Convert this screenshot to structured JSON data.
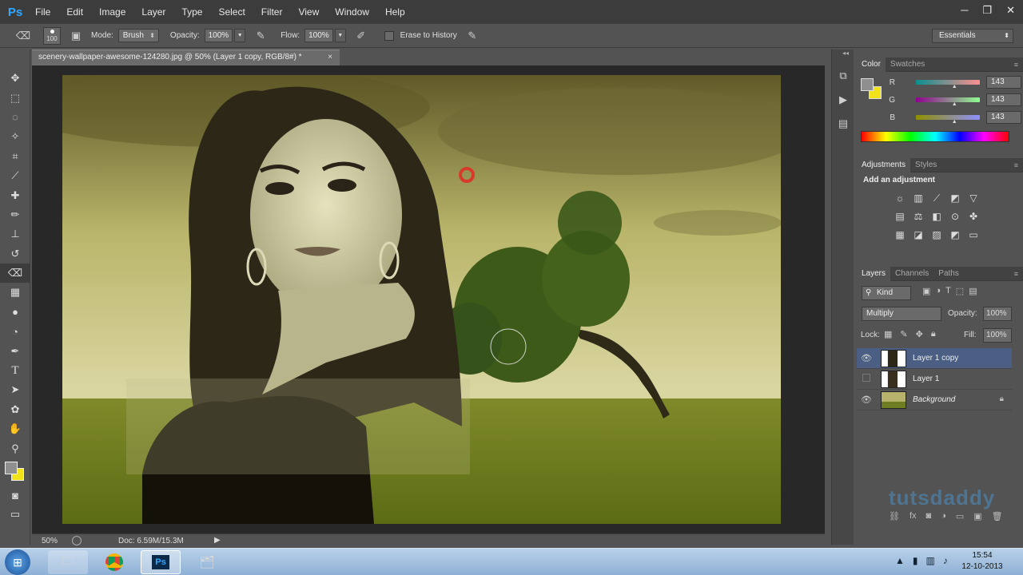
{
  "app": {
    "logo": "Ps"
  },
  "menu": [
    "File",
    "Edit",
    "Image",
    "Layer",
    "Type",
    "Select",
    "Filter",
    "View",
    "Window",
    "Help"
  ],
  "window_controls": {
    "minimize": "─",
    "restore": "❐",
    "close": "✕"
  },
  "options_bar": {
    "brush_size": "100",
    "mode_label": "Mode:",
    "mode_value": "Brush",
    "opacity_label": "Opacity:",
    "opacity_value": "100%",
    "flow_label": "Flow:",
    "flow_value": "100%",
    "erase_history_label": "Erase to History",
    "workspace": "Essentials"
  },
  "document": {
    "tab_title": "scenery-wallpaper-awesome-124280.jpg @ 50% (Layer 1 copy, RGB/8#) *",
    "close": "×"
  },
  "status_bar": {
    "zoom": "50%",
    "doc_info": "Doc: 6.59M/15.3M"
  },
  "color_panel": {
    "tabs": [
      "Color",
      "Swatches"
    ],
    "channels": [
      {
        "name": "R",
        "value": "143",
        "gradient": "linear-gradient(90deg,#0a8f8f,#ff8f8f)",
        "position": 0.56
      },
      {
        "name": "G",
        "value": "143",
        "gradient": "linear-gradient(90deg,#8f008f,#8fff8f)",
        "position": 0.56
      },
      {
        "name": "B",
        "value": "143",
        "gradient": "linear-gradient(90deg,#8f8f00,#8f8fff)",
        "position": 0.56
      }
    ],
    "foreground_color": "#8f8f8f",
    "background_color": "#f2e21a"
  },
  "adjustments_panel": {
    "tabs": [
      "Adjustments",
      "Styles"
    ],
    "heading": "Add an adjustment"
  },
  "layers_panel": {
    "tabs": [
      "Layers",
      "Channels",
      "Paths"
    ],
    "kind_filter": "Kind",
    "blend_mode": "Multiply",
    "opacity_label": "Opacity:",
    "opacity_value": "100%",
    "lock_label": "Lock:",
    "fill_label": "Fill:",
    "fill_value": "100%",
    "layers": [
      {
        "name": "Layer 1 copy",
        "visible": true,
        "selected": true
      },
      {
        "name": "Layer 1",
        "visible": false,
        "selected": false
      },
      {
        "name": "Background",
        "visible": true,
        "selected": false,
        "locked": true
      }
    ]
  },
  "watermark": "tutsdaddy",
  "taskbar": {
    "time": "15:54",
    "date": "12-10-2013"
  }
}
